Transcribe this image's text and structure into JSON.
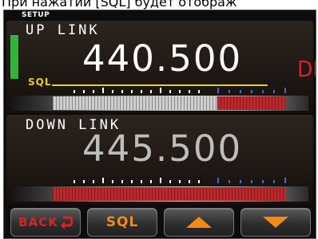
{
  "caption": {
    "text": "При нажатии [SQL] будет отображ"
  },
  "screen": {
    "title": "SETUP"
  },
  "uplink": {
    "title": "UP LINK",
    "frequency": "440.500",
    "mode": "DN",
    "squelch_label": "SQL"
  },
  "downlink": {
    "title": "DOWN LINK",
    "frequency": "445.500"
  },
  "buttons": {
    "back": "BACK",
    "sql": "SQL",
    "up_icon": "triangle-up-icon",
    "down_icon": "triangle-down-icon"
  },
  "colors": {
    "accent_red": "#d8222a",
    "accent_orange": "#f28a1a",
    "squelch_yellow": "#e6d21a",
    "indicator_green": "#32b43c"
  }
}
